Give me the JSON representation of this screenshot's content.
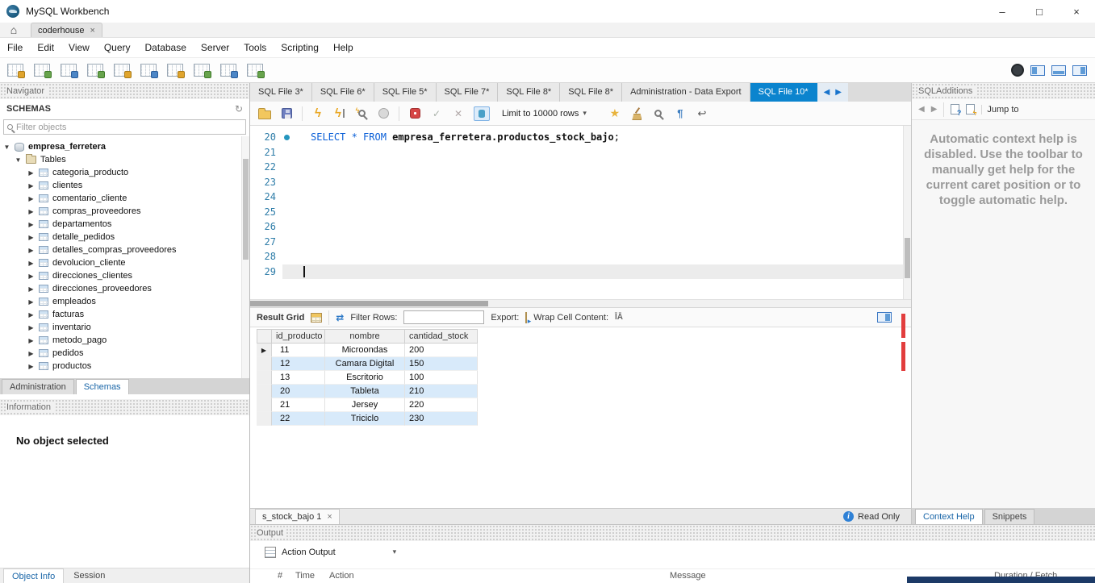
{
  "icons": {
    "home": "⌂",
    "minimize": "–",
    "maximize": "□",
    "close": "×",
    "tab_close": "×",
    "expand_collapsed": "▶",
    "expand_expanded": "▼",
    "row_pointer": "▶",
    "bolt": "ϟ",
    "check": "✓",
    "cross": "✕",
    "star": "★",
    "pilcrow": "¶",
    "wrap_text": "↩",
    "refresh_arrows": "⇄",
    "schema_refresh": "↻",
    "dropdown_caret": "▾",
    "back_arrow": "◀",
    "forward_arrow": "▶",
    "info": "i",
    "wrap_cell": "ĪĀ"
  },
  "titlebar": {
    "app_title": "MySQL Workbench"
  },
  "home_row": {
    "connection_tab": "coderhouse"
  },
  "menubar": {
    "items": [
      "File",
      "Edit",
      "View",
      "Query",
      "Database",
      "Server",
      "Tools",
      "Scripting",
      "Help"
    ]
  },
  "main_toolbar": {
    "left_icons": [
      "new-sql-tab-icon",
      "open-sql-script-icon",
      "connection-options-icon",
      "create-schema-icon",
      "create-table-icon",
      "create-view-icon",
      "create-procedure-icon",
      "create-function-icon",
      "search-table-data-icon",
      "reconnect-server-icon"
    ],
    "right_icons": [
      "notifications-icon",
      "toggle-left-sidebar-icon",
      "toggle-output-area-icon",
      "toggle-right-sidebar-icon"
    ]
  },
  "sql_tabs": {
    "tabs": [
      {
        "label": "SQL File 3*",
        "active": false
      },
      {
        "label": "SQL File 6*",
        "active": false
      },
      {
        "label": "SQL File 5*",
        "active": false
      },
      {
        "label": "SQL File 7*",
        "active": false
      },
      {
        "label": "SQL File 8*",
        "active": false
      },
      {
        "label": "SQL File 8*",
        "active": false
      },
      {
        "label": "Administration - Data Export",
        "active": false
      },
      {
        "label": "SQL File 10*",
        "active": true
      }
    ]
  },
  "editor_toolbar": {
    "limit_label": "Limit to 10000 rows"
  },
  "editor": {
    "line_numbers": [
      "20",
      "21",
      "22",
      "23",
      "24",
      "25",
      "26",
      "27",
      "28",
      "29"
    ],
    "sql": {
      "select_kw": "SELECT",
      "star": "*",
      "from_kw": "FROM",
      "identifier": "empresa_ferretera.productos_stock_bajo",
      "terminator": ";"
    }
  },
  "navigator": {
    "panel_title": "Navigator",
    "schemas_title": "SCHEMAS",
    "filter_placeholder": "Filter objects",
    "schema_name": "empresa_ferretera",
    "tables_folder_label": "Tables",
    "tables": [
      "categoria_producto",
      "clientes",
      "comentario_cliente",
      "compras_proveedores",
      "departamentos",
      "detalle_pedidos",
      "detalles_compras_proveedores",
      "devolucion_cliente",
      "direcciones_clientes",
      "direcciones_proveedores",
      "empleados",
      "facturas",
      "inventario",
      "metodo_pago",
      "pedidos",
      "productos"
    ],
    "panel_tabs": {
      "administration": "Administration",
      "schemas": "Schemas"
    },
    "information_title": "Information",
    "no_object_text": "No object selected",
    "bottom_tabs": {
      "object_info": "Object Info",
      "session": "Session"
    }
  },
  "result_grid": {
    "toolbar": {
      "title": "Result Grid",
      "filter_label": "Filter Rows:",
      "filter_value": "",
      "export_label": "Export:",
      "wrap_label": "Wrap Cell Content:"
    },
    "columns": [
      "id_producto",
      "nombre",
      "cantidad_stock"
    ],
    "rows": [
      [
        "11",
        "Microondas",
        "200"
      ],
      [
        "12",
        "Camara Digital",
        "150"
      ],
      [
        "13",
        "Escritorio",
        "100"
      ],
      [
        "20",
        "Tableta",
        "210"
      ],
      [
        "21",
        "Jersey",
        "220"
      ],
      [
        "22",
        "Triciclo",
        "230"
      ]
    ],
    "result_tab_label": "s_stock_bajo 1",
    "read_only_label": "Read Only"
  },
  "sql_additions": {
    "panel_title": "SQLAdditions",
    "jump_label": "Jump to",
    "help_text": "Automatic context help is disabled. Use the toolbar to manually get help for the current caret position or to toggle automatic help.",
    "tabs": {
      "context_help": "Context Help",
      "snippets": "Snippets"
    }
  },
  "output": {
    "panel_title": "Output",
    "selector_value": "Action Output",
    "columns": [
      "#",
      "Time",
      "Action",
      "Message",
      "Duration / Fetch"
    ]
  }
}
